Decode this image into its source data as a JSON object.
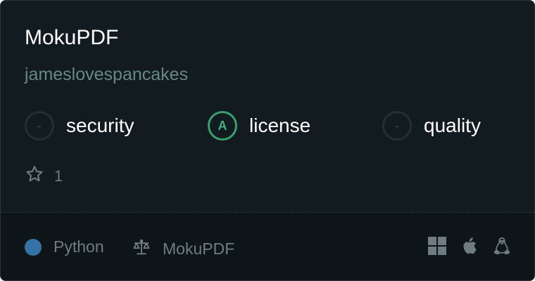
{
  "repo": {
    "name": "MokuPDF",
    "owner": "jameslovespancakes"
  },
  "metrics": [
    {
      "grade": "-",
      "label": "security",
      "status": "none"
    },
    {
      "grade": "A",
      "label": "license",
      "status": "good"
    },
    {
      "grade": "-",
      "label": "quality",
      "status": "none"
    }
  ],
  "stars": {
    "icon": "star-icon",
    "count": "1"
  },
  "footer": {
    "language": {
      "name": "Python",
      "color": "#3572a5"
    },
    "license": {
      "icon": "scale-icon",
      "name": "MokuPDF"
    },
    "platforms": [
      "windows-icon",
      "apple-icon",
      "linux-icon"
    ]
  },
  "colors": {
    "background": "#121b1f",
    "footer_background": "#0e1518",
    "accent_good": "#3a9f6d",
    "muted_text": "#6f7c82",
    "owner_text": "#6a8782"
  }
}
